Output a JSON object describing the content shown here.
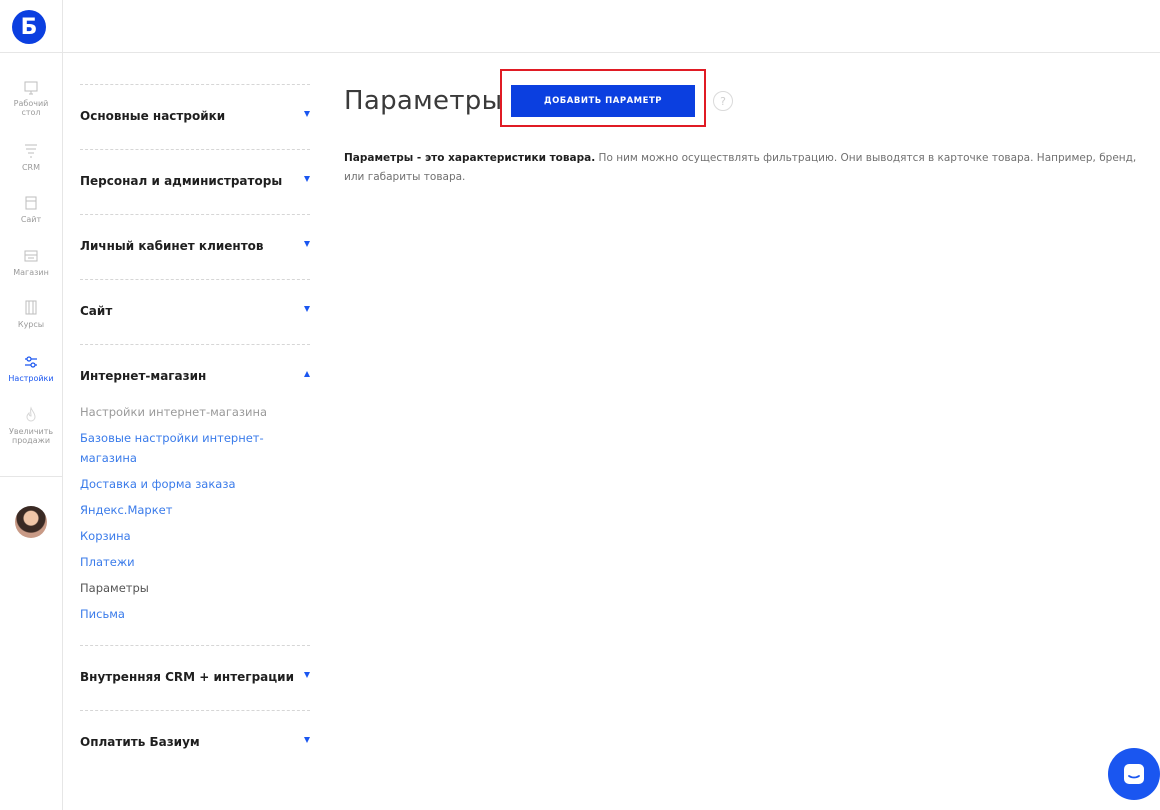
{
  "logo": {
    "letter": "Б"
  },
  "rail": [
    {
      "id": "desktop",
      "label": "Рабочий стол"
    },
    {
      "id": "crm",
      "label": "CRM"
    },
    {
      "id": "site",
      "label": "Сайт"
    },
    {
      "id": "shop",
      "label": "Магазин"
    },
    {
      "id": "courses",
      "label": "Курсы"
    },
    {
      "id": "settings",
      "label": "Настройки"
    },
    {
      "id": "sales",
      "label": "Увеличить продажи"
    }
  ],
  "sidebar": {
    "sections": [
      {
        "title": "Основные настройки"
      },
      {
        "title": "Персонал и администраторы"
      },
      {
        "title": "Личный кабинет клиентов"
      },
      {
        "title": "Сайт"
      },
      {
        "title": "Интернет-магазин"
      }
    ],
    "shop_items": [
      "Настройки интернет-магазина",
      "Базовые настройки интернет-магазина",
      "Доставка и форма заказа",
      "Яндекс.Маркет",
      "Корзина",
      "Платежи",
      "Параметры",
      "Письма"
    ],
    "sections_after": [
      {
        "title": "Внутренняя CRM + интеграции"
      },
      {
        "title": "Оплатить Базиум"
      }
    ]
  },
  "main": {
    "title": "Параметры",
    "add_button": "ДОБАВИТЬ ПАРАМЕТР",
    "help": "?",
    "desc_bold": "Параметры - это характеристики товара.",
    "desc_rest": " По ним можно осуществлять фильтрацию. Они выводятся в карточке товара. Например, бренд, или габариты товара."
  },
  "colors": {
    "accent": "#0b3fe0",
    "link": "#3a7bea",
    "highlight": "#e01b24"
  }
}
